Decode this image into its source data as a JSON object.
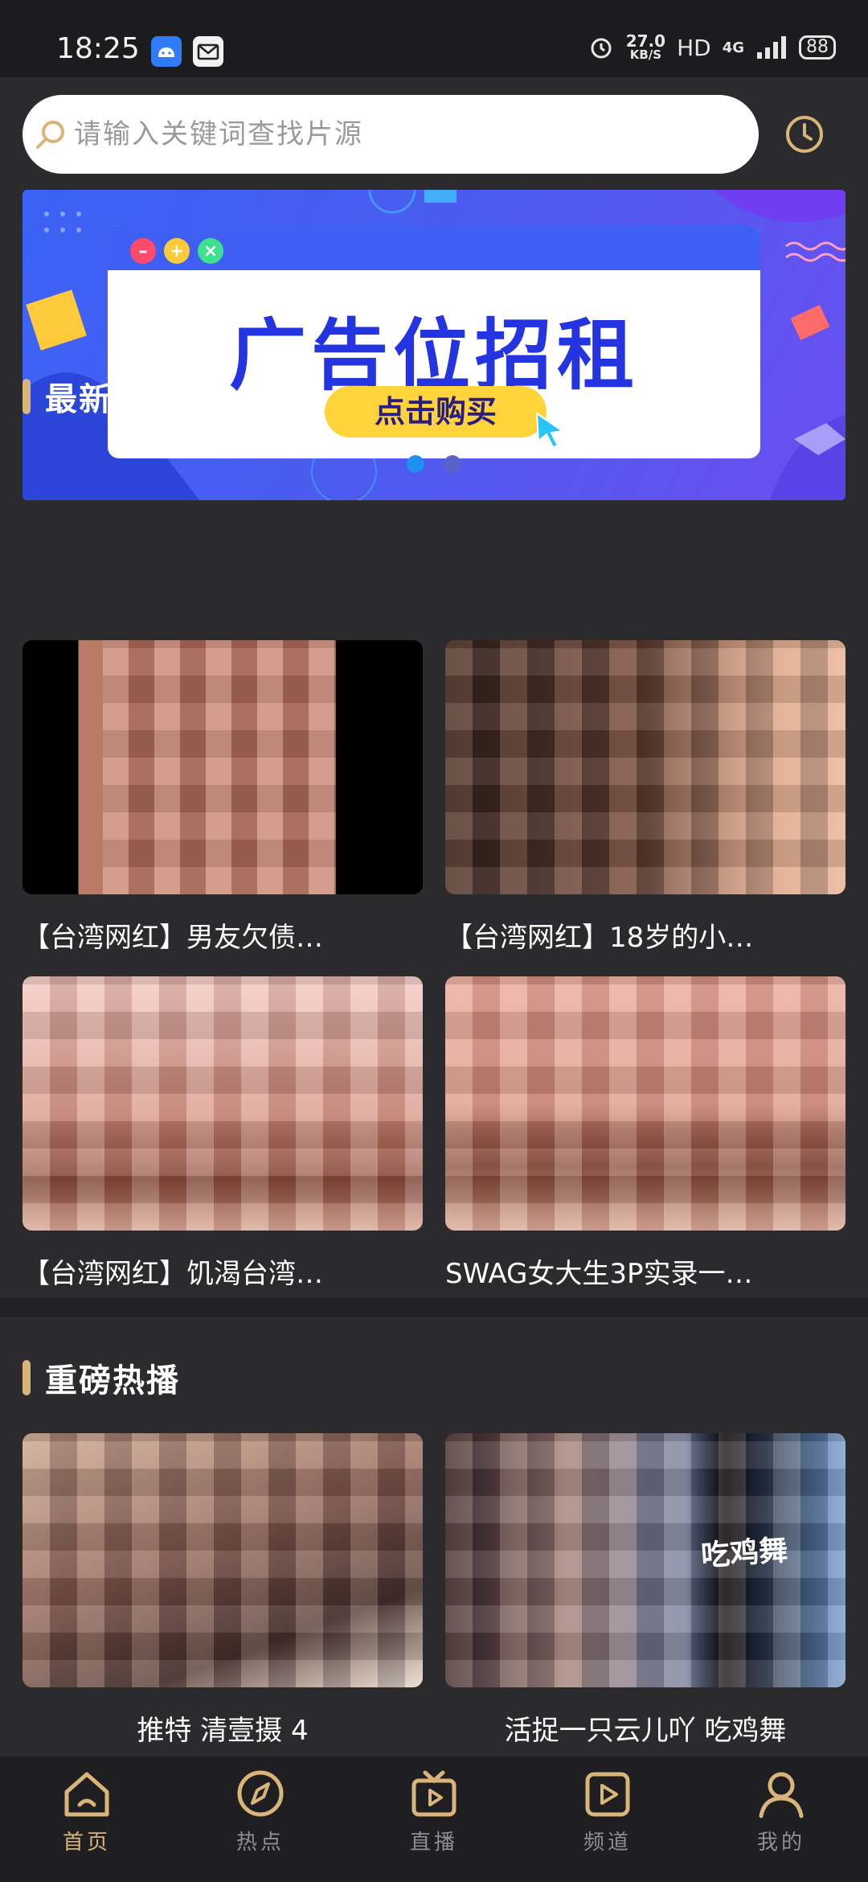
{
  "status_bar": {
    "time": "18:25",
    "speed_value": "27.0",
    "speed_unit": "KB/S",
    "hd": "HD",
    "network": "4G",
    "battery": "88"
  },
  "search": {
    "placeholder": "请输入关键词查找片源"
  },
  "banner": {
    "headline": "广告位招租",
    "cta": "点击购买"
  },
  "sections": [
    {
      "title": "最新片源",
      "items": [
        {
          "caption": "【台湾网红】男友欠债…"
        },
        {
          "caption": "【台湾网红】18岁的小…"
        },
        {
          "caption": "【台湾网红】饥渴台湾…"
        },
        {
          "caption": "SWAG女大生3P实录一…"
        }
      ]
    },
    {
      "title": "重磅热播",
      "items": [
        {
          "caption": "推特 清壹摄 4"
        },
        {
          "caption": "活捉一只云儿吖 吃鸡舞",
          "overlay": "吃鸡舞"
        }
      ]
    }
  ],
  "tabs": [
    {
      "label": "首页",
      "icon": "home-icon"
    },
    {
      "label": "热点",
      "icon": "compass-icon"
    },
    {
      "label": "直播",
      "icon": "tv-icon"
    },
    {
      "label": "频道",
      "icon": "play-icon"
    },
    {
      "label": "我的",
      "icon": "user-icon"
    }
  ],
  "colors": {
    "accent": "#d9b57a",
    "background": "#2b2b2d",
    "tabbar": "#1f1f21",
    "banner_blue": "#3b63f5"
  }
}
